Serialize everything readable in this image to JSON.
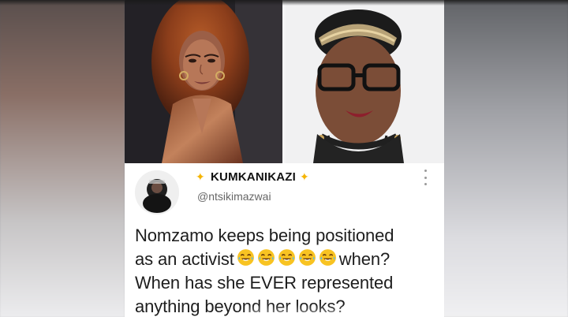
{
  "tweet": {
    "display_name": "KUMKANIKAZI",
    "handle": "@ntsikimazwai",
    "lines": [
      "Nomzamo keeps being positioned",
      "as an activist",
      "when?",
      "When has she EVER represented",
      "anything beyond her looks?"
    ]
  },
  "colors": {
    "card_background": "#ffffff",
    "text_primary": "#1d1d1d",
    "text_secondary": "#666666",
    "sparkle": "#f5b400"
  },
  "icons": {
    "sparkle_left": "sparkle-icon",
    "sparkle_right": "sparkle-icon",
    "more_options": "more-options-icon",
    "emoji": "face-with-tears-of-joy-icon"
  }
}
